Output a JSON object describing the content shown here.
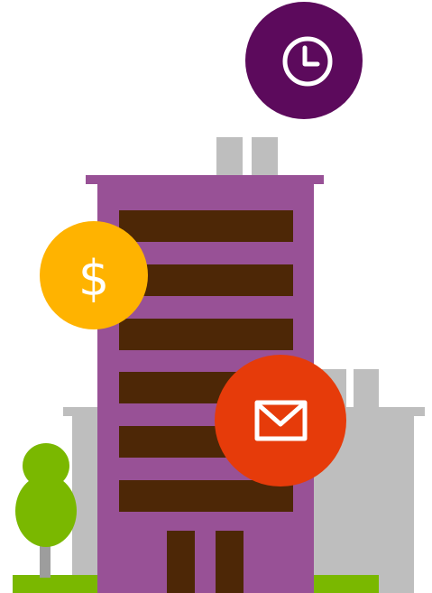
{
  "illustration": {
    "badges": {
      "clock": {
        "icon": "clock-icon",
        "color": "#5c0a5c"
      },
      "dollar": {
        "icon": "dollar-icon",
        "symbol": "$",
        "color": "#ffb300"
      },
      "mail": {
        "icon": "mail-icon",
        "color": "#e63b0a"
      }
    },
    "colors": {
      "building": "#985196",
      "windows": "#4d2706",
      "background_buildings": "#bebebe",
      "grass": "#7ab800",
      "tree": "#7ab800",
      "tree_trunk": "#9d9d9d"
    }
  }
}
